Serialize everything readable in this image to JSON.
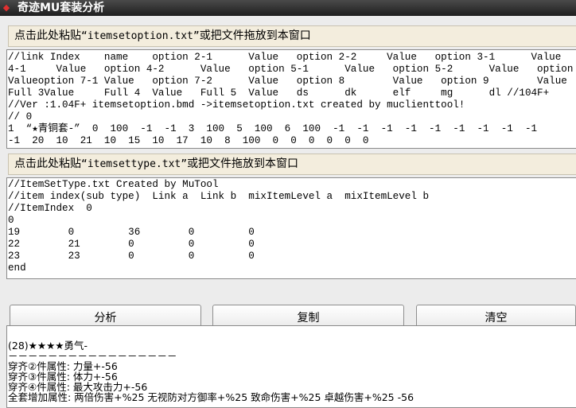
{
  "window": {
    "title": "奇迹MU套装分析",
    "icon": "app-icon"
  },
  "option_bar": {
    "prefix": "点击此处粘贴",
    "filename": "“itemsetoption.txt”",
    "suffix": "或把文件拖放到本窗口"
  },
  "option_text": {
    "lines": [
      "//link Index    name    option 2-1      Value   option 2-2     Value   option 3-1      Value",
      "4-1     Value   option 4-2      Value   option 5-1      Value   option 5-2      Value   option",
      "Valueoption 7-1 Value   option 7-2      Value   option 8        Value   option 9        Value",
      "Full 3Value     Full 4  Value   Full 5  Value   ds      dk      elf     mg      dl //104F+",
      "//Ver :1.04F+ itemsetoption.bmd ->itemsetoption.txt created by muclienttool!",
      "// 0",
      "1  “★青铜套-”  0  100  -1  -1  3  100  5  100  6  100  -1  -1  -1  -1  -1  -1  -1  -1  -1",
      "-1  20  10  21  10  15  10  17  10  8  100  0  0  0  0  0  0"
    ]
  },
  "type_bar": {
    "prefix": "点击此处粘贴",
    "filename": "“itemsettype.txt”",
    "suffix": "或把文件拖放到本窗口"
  },
  "type_text": {
    "lines": [
      "//ItemSetType.txt Created by MuTool",
      "//item index(sub type)  Link a  Link b  mixItemLevel a  mixItemLevel b",
      "//ItemIndex  0",
      "0",
      "19        0         36        0         0",
      "22        21        0         0         0",
      "23        23        0         0         0",
      "end"
    ]
  },
  "buttons": {
    "analyze": "分析",
    "copy": "复制",
    "clear": "清空"
  },
  "result_text": {
    "lines": [
      "(28)★★★★勇气-",
      "－－－－－－－－－－－－－－－－－",
      "穿齐②件属性: 力量+-56",
      "穿齐③件属性: 体力+-56",
      "穿齐④件属性: 最大攻击力+-56",
      "全套增加属性: 两倍伤害+%25 无视防对方御率+%25 致命伤害+%25 卓越伤害+%25 -56"
    ]
  }
}
